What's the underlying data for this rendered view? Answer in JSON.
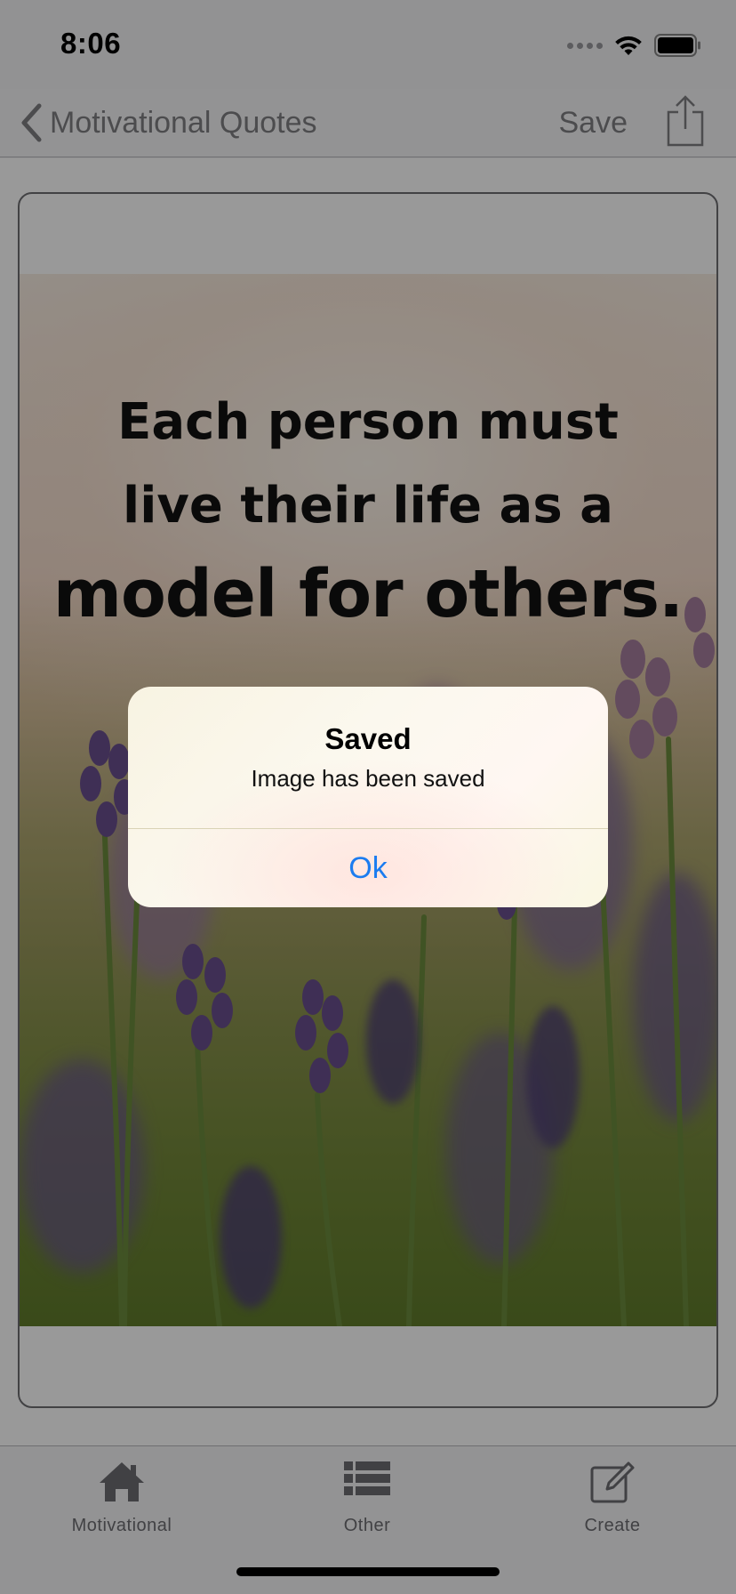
{
  "status_bar": {
    "time": "8:06"
  },
  "nav": {
    "back_label": "Motivational Quotes",
    "save_label": "Save"
  },
  "quote": {
    "line1": "Each person must",
    "line2": "live their life as a",
    "line3": "model for others."
  },
  "tabs": [
    {
      "label": "Motivational",
      "icon": "house-icon"
    },
    {
      "label": "Other",
      "icon": "list-icon"
    },
    {
      "label": "Create",
      "icon": "compose-icon"
    }
  ],
  "alert": {
    "title": "Saved",
    "message": "Image has been saved",
    "ok_label": "Ok"
  },
  "colors": {
    "alert_button": "#1b7cf0",
    "dim_overlay": "rgba(0,0,0,0.4)",
    "nav_text": "#7f7f83"
  }
}
